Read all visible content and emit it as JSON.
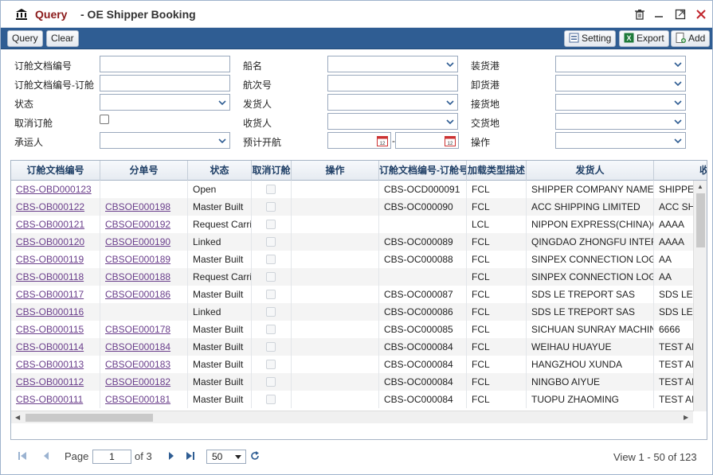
{
  "window": {
    "title_prefix": "Query",
    "title_main": "- OE Shipper Booking"
  },
  "toolbar": {
    "query": "Query",
    "clear": "Clear",
    "setting": "Setting",
    "export": "Export",
    "add": "Add"
  },
  "form": {
    "col1": [
      {
        "label": "订舱文档编号"
      },
      {
        "label": "订舱文档编号-订舱"
      },
      {
        "label": "状态"
      },
      {
        "label": "取消订舱"
      },
      {
        "label": "承运人"
      }
    ],
    "col2": [
      {
        "label": "船名"
      },
      {
        "label": "航次号"
      },
      {
        "label": "发货人"
      },
      {
        "label": "收货人"
      },
      {
        "label": "预计开航",
        "date_sep": "-"
      }
    ],
    "col3": [
      {
        "label": "装货港"
      },
      {
        "label": "卸货港"
      },
      {
        "label": "接货地"
      },
      {
        "label": "交货地"
      },
      {
        "label": "操作"
      }
    ]
  },
  "grid": {
    "headers": [
      "订舱文档编号",
      "分单号",
      "状态",
      "取消订舱",
      "操作",
      "订舱文档编号-订舱号",
      "加载类型描述",
      "发货人",
      "收"
    ],
    "rows": [
      {
        "c0": "CBS-OBD000123",
        "c1": "",
        "c2": "Open",
        "c5": "CBS-OCD000091",
        "c6": "FCL",
        "c7": "SHIPPER COMPANY NAME",
        "c8": "SHIPPER"
      },
      {
        "c0": "CBS-OB000122",
        "c1": "CBSOE000198",
        "c2": "Master Built",
        "c5": "CBS-OC000090",
        "c6": "FCL",
        "c7": "ACC SHIPPING LIMITED",
        "c8": "ACC SHI"
      },
      {
        "c0": "CBS-OB000121",
        "c1": "CBSOE000192",
        "c2": "Request Carrier",
        "c5": "",
        "c6": "LCL",
        "c7": "NIPPON EXPRESS(CHINA)CO",
        "c8": "AAAA"
      },
      {
        "c0": "CBS-OB000120",
        "c1": "CBSOE000190",
        "c2": "Linked",
        "c5": "CBS-OC000089",
        "c6": "FCL",
        "c7": "QINGDAO ZHONGFU INTER",
        "c8": "AAAA"
      },
      {
        "c0": "CBS-OB000119",
        "c1": "CBSOE000189",
        "c2": "Master Built",
        "c5": "CBS-OC000088",
        "c6": "FCL",
        "c7": "SINPEX CONNECTION LOG",
        "c8": "AA"
      },
      {
        "c0": "CBS-OB000118",
        "c1": "CBSOE000188",
        "c2": "Request Carrier",
        "c5": "",
        "c6": "FCL",
        "c7": "SINPEX CONNECTION LOG",
        "c8": "AA"
      },
      {
        "c0": "CBS-OB000117",
        "c1": "CBSOE000186",
        "c2": "Master Built",
        "c5": "CBS-OC000087",
        "c6": "FCL",
        "c7": "SDS LE TREPORT SAS",
        "c8": "SDS LE"
      },
      {
        "c0": "CBS-OB000116",
        "c1": "",
        "c2": "Linked",
        "c5": "CBS-OC000086",
        "c6": "FCL",
        "c7": "SDS LE TREPORT SAS",
        "c8": "SDS LE"
      },
      {
        "c0": "CBS-OB000115",
        "c1": "CBSOE000178",
        "c2": "Master Built",
        "c5": "CBS-OC000085",
        "c6": "FCL",
        "c7": "SICHUAN SUNRAY MACHINE",
        "c8": "6666"
      },
      {
        "c0": "CBS-OB000114",
        "c1": "CBSOE000184",
        "c2": "Master Built",
        "c5": "CBS-OC000084",
        "c6": "FCL",
        "c7": "WEIHAU HUAYUE",
        "c8": "TEST AB"
      },
      {
        "c0": "CBS-OB000113",
        "c1": "CBSOE000183",
        "c2": "Master Built",
        "c5": "CBS-OC000084",
        "c6": "FCL",
        "c7": "HANGZHOU XUNDA",
        "c8": "TEST AB"
      },
      {
        "c0": "CBS-OB000112",
        "c1": "CBSOE000182",
        "c2": "Master Built",
        "c5": "CBS-OC000084",
        "c6": "FCL",
        "c7": "NINGBO AIYUE",
        "c8": "TEST AB"
      },
      {
        "c0": "CBS-OB000111",
        "c1": "CBSOE000181",
        "c2": "Master Built",
        "c5": "CBS-OC000084",
        "c6": "FCL",
        "c7": "TUOPU ZHAOMING",
        "c8": "TEST AB"
      }
    ]
  },
  "pager": {
    "page_label": "Page",
    "page_value": "1",
    "of_label": "of 3",
    "page_size": "50",
    "page_size_options": [
      "50"
    ],
    "view_text": "View 1 - 50 of 123"
  },
  "icons": {
    "logo": "bank-icon",
    "delete": "trash-icon",
    "minimize": "minimize-icon",
    "maximize": "maximize-icon",
    "close": "close-icon",
    "setting": "setting-icon",
    "export": "excel-icon",
    "add": "add-icon"
  },
  "colors": {
    "title_red": "#8b1a1a",
    "toolbar_bg": "#2f5d93",
    "link": "#6b3f8c",
    "header_text": "#1f3f66",
    "close_red": "#c0262d"
  }
}
